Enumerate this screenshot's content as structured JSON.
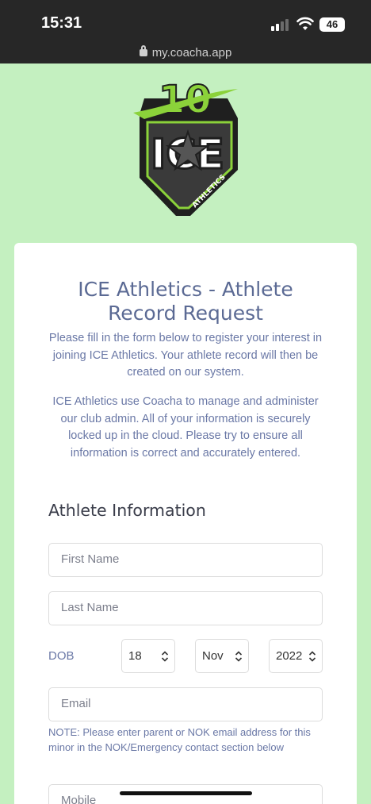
{
  "status": {
    "time": "15:31",
    "battery": "46",
    "url": "my.coacha.app"
  },
  "logo": {
    "number": "10",
    "brand": "ICE",
    "tagline": "ATHLETICS"
  },
  "form": {
    "title_line1": "ICE Athletics - Athlete",
    "title_line2": "Record Request",
    "intro1": "Please fill in the form below to register your interest in joining ICE Athletics. Your athlete record will then be created on our system.",
    "intro2": "ICE Athletics use Coacha to manage and administer our club admin. All of your information is securely locked up in the cloud. Please try to ensure all information is correct and accurately entered.",
    "section_title": "Athlete Information",
    "first_name_placeholder": "First Name",
    "last_name_placeholder": "Last Name",
    "dob_label": "DOB",
    "dob_day": "18",
    "dob_month": "Nov",
    "dob_year": "2022",
    "email_placeholder": "Email",
    "email_note": "NOTE: Please enter parent or NOK email address for this minor in the NOK/Emergency contact section below",
    "mobile_placeholder": "Mobile"
  },
  "colors": {
    "page_background": "#c4f0c0",
    "status_bar": "#272727",
    "title_color": "#5b6a94",
    "logo_green": "#8bd23a"
  }
}
